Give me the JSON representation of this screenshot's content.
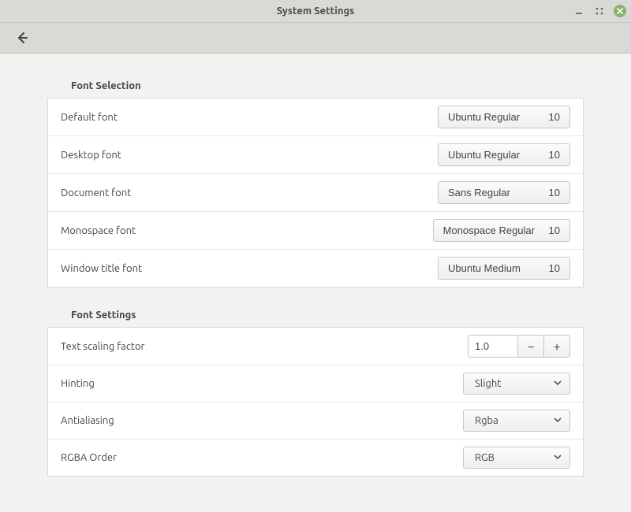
{
  "window": {
    "title": "System Settings"
  },
  "sections": {
    "fontSelection": {
      "title": "Font Selection",
      "rows": [
        {
          "label": "Default font",
          "font": "Ubuntu Regular",
          "size": "10"
        },
        {
          "label": "Desktop font",
          "font": "Ubuntu Regular",
          "size": "10"
        },
        {
          "label": "Document font",
          "font": "Sans Regular",
          "size": "10"
        },
        {
          "label": "Monospace font",
          "font": "Monospace Regular",
          "size": "10"
        },
        {
          "label": "Window title font",
          "font": "Ubuntu Medium",
          "size": "10"
        }
      ]
    },
    "fontSettings": {
      "title": "Font Settings",
      "textScaling": {
        "label": "Text scaling factor",
        "value": "1.0"
      },
      "hinting": {
        "label": "Hinting",
        "value": "Slight"
      },
      "antialiasing": {
        "label": "Antialiasing",
        "value": "Rgba"
      },
      "rgbaOrder": {
        "label": "RGBA Order",
        "value": "RGB"
      }
    }
  }
}
